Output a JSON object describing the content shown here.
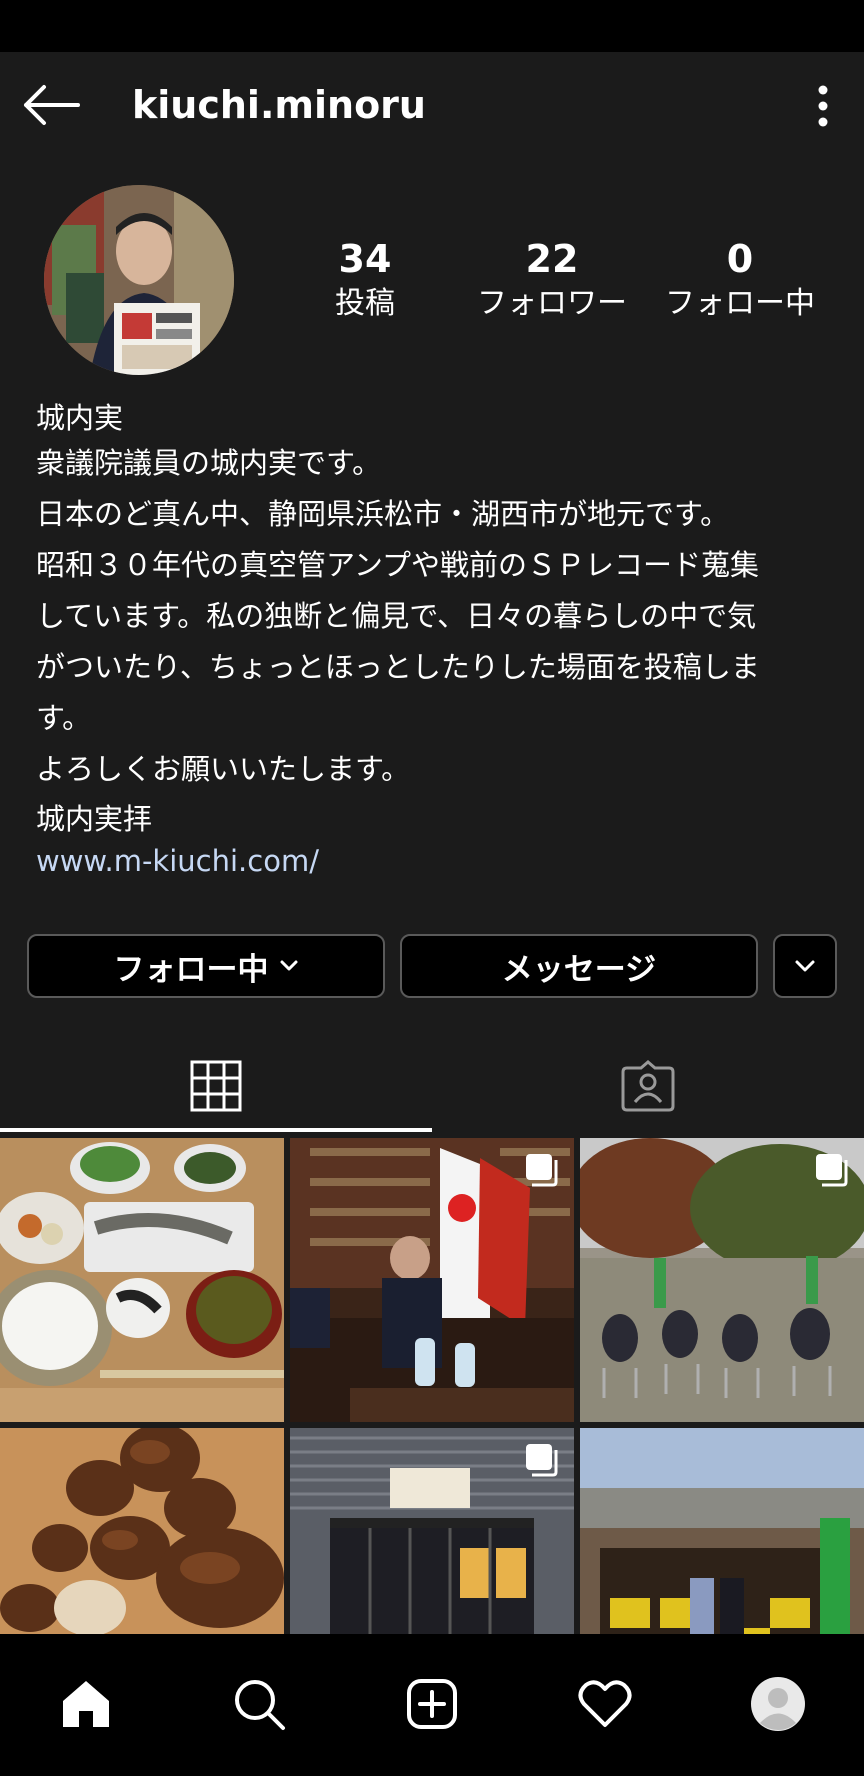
{
  "header": {
    "username": "kiuchi.minoru",
    "back_icon": "arrow-left-icon",
    "menu_icon": "more-vertical-icon"
  },
  "profile": {
    "stats": [
      {
        "count": "34",
        "label": "投稿"
      },
      {
        "count": "22",
        "label": "フォロワー"
      },
      {
        "count": "0",
        "label": "フォロー中"
      }
    ],
    "name": "城内実",
    "bio_lines": [
      "衆議院議員の城内実です。",
      "日本のど真ん中、静岡県浜松市・湖西市が地元です。",
      "昭和３０年代の真空管アンプや戦前のＳＰレコード蒐集",
      "しています。私の独断と偏見で、日々の暮らしの中で気",
      "がついたり、ちょっとほっとしたりした場面を投稿しま",
      "す。",
      "よろしくお願いいたします。"
    ],
    "signature": "城内実拝",
    "website": "www.m-kiuchi.com/"
  },
  "actions": {
    "following_label": "フォロー中",
    "message_label": "メッセージ"
  },
  "tabs": [
    {
      "name": "grid",
      "icon": "grid-icon",
      "active": true
    },
    {
      "name": "tagged",
      "icon": "tagged-person-icon",
      "active": false
    }
  ],
  "posts": [
    {
      "subject": "japanese-meal-food",
      "multi": false
    },
    {
      "subject": "office-meeting-flags",
      "multi": true
    },
    {
      "subject": "outdoor-gathering-tree",
      "multi": true
    },
    {
      "subject": "shiitake-mushrooms",
      "multi": false
    },
    {
      "subject": "shop-storefront",
      "multi": true
    },
    {
      "subject": "farm-market-visit",
      "multi": false
    }
  ],
  "bottom_nav": [
    "home-icon",
    "search-icon",
    "new-post-icon",
    "activity-heart-icon",
    "profile-avatar-icon"
  ],
  "colors": {
    "background": "#1b1b1b",
    "link": "#c6d8f4",
    "button_border": "#5a5a5a"
  }
}
